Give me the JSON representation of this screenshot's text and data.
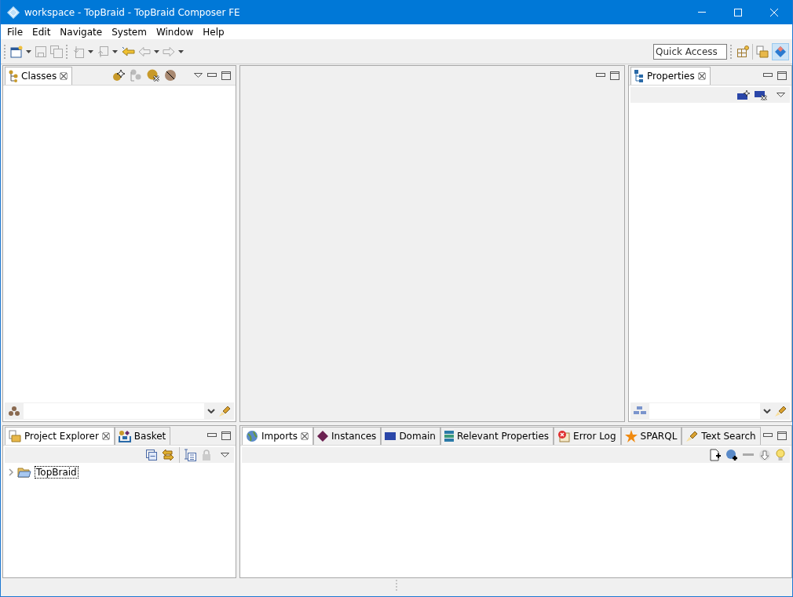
{
  "window": {
    "title": "workspace - TopBraid - TopBraid Composer FE"
  },
  "menu": [
    "File",
    "Edit",
    "Navigate",
    "System",
    "Window",
    "Help"
  ],
  "quick_access": {
    "placeholder": "Quick Access"
  },
  "classes_panel": {
    "tabs": [
      {
        "label": "Classes",
        "selected": true
      }
    ]
  },
  "properties_panel": {
    "tabs": [
      {
        "label": "Properties",
        "selected": true
      }
    ]
  },
  "explorer_panel": {
    "tabs": [
      {
        "label": "Project Explorer",
        "selected": true
      },
      {
        "label": "Basket",
        "selected": false
      }
    ],
    "tree": [
      {
        "label": "TopBraid",
        "expanded": false,
        "selected": true
      }
    ]
  },
  "bottom_panel": {
    "tabs": [
      {
        "label": "Imports",
        "selected": true
      },
      {
        "label": "Instances",
        "selected": false
      },
      {
        "label": "Domain",
        "selected": false
      },
      {
        "label": "Relevant Properties",
        "selected": false
      },
      {
        "label": "Error Log",
        "selected": false
      },
      {
        "label": "SPARQL",
        "selected": false
      },
      {
        "label": "Text Search",
        "selected": false
      }
    ]
  }
}
